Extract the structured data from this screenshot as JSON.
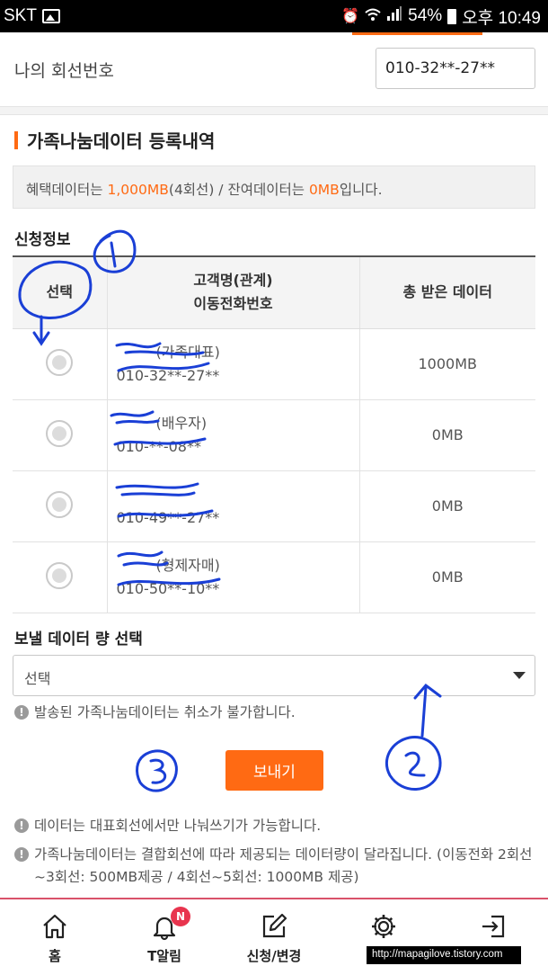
{
  "status_bar": {
    "carrier": "SKT",
    "battery": "54%",
    "time": "오후 10:49"
  },
  "my_line": {
    "label": "나의 회선번호",
    "value": "010-32**-27**"
  },
  "section_title": "가족나눔데이터 등록내역",
  "benefit": {
    "prefix": "혜택데이터는 ",
    "amount": "1,000MB",
    "count": "(4회선) / 잔여데이터는 ",
    "remaining": "0MB",
    "suffix": "입니다."
  },
  "apply_info": {
    "title": "신청정보",
    "headers": {
      "select": "선택",
      "name": "고객명(관계)",
      "phone": "이동전화번호",
      "data": "총 받은 데이터"
    },
    "rows": [
      {
        "name": "(가족대표)",
        "phone": "010-32**-27**",
        "data": "1000MB"
      },
      {
        "name": "(배우자)",
        "phone": "010-**-08**",
        "data": "0MB"
      },
      {
        "name": "",
        "phone": "010-49**-27**",
        "data": "0MB"
      },
      {
        "name": "(형제자매)",
        "phone": "010-50**-10**",
        "data": "0MB"
      }
    ]
  },
  "send": {
    "title": "보낼 데이터 량 선택",
    "select_value": "선택",
    "cancel_notice": "발송된 가족나눔데이터는 취소가 불가합니다.",
    "button": "보내기"
  },
  "notes": [
    "데이터는 대표회선에서만 나눠쓰기가 가능합니다.",
    "가족나눔데이터는 결합회선에 따라 제공되는 데이터량이 달라집니다. (이동전화 2회선~3회선: 500MB제공 / 4회선~5회선: 1000MB 제공)"
  ],
  "bottom_nav": [
    {
      "label": "홈",
      "icon": "home-icon"
    },
    {
      "label": "T알림",
      "icon": "bell-icon",
      "badge": "N"
    },
    {
      "label": "신청/변경",
      "icon": "edit-icon"
    },
    {
      "label": "",
      "icon": "gear-icon"
    },
    {
      "label": "",
      "icon": "logout-icon"
    }
  ],
  "watermark": "http://mapagilove.tistory.com",
  "colors": {
    "accent": "#ff6a13",
    "annotation": "#1a3fd6",
    "badge": "#e8344e"
  }
}
